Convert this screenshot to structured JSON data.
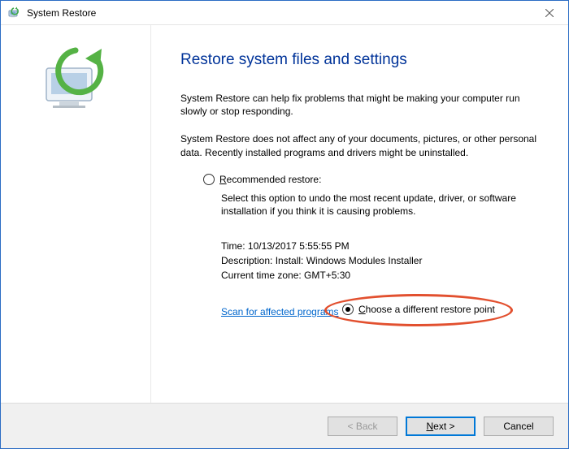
{
  "window": {
    "title": "System Restore"
  },
  "page": {
    "heading": "Restore system files and settings",
    "para1": "System Restore can help fix problems that might be making your computer run slowly or stop responding.",
    "para2": "System Restore does not affect any of your documents, pictures, or other personal data. Recently installed programs and drivers might be uninstalled."
  },
  "options": {
    "recommended": {
      "label_prefix": "R",
      "label_rest": "ecommended restore:",
      "desc": "Select this option to undo the most recent update, driver, or software installation if you think it is causing problems.",
      "time_label": "Time: ",
      "time_value": "10/13/2017 5:55:55 PM",
      "desc_label": "Description: ",
      "desc_value": "Install: Windows Modules Installer",
      "tz_label": "Current time zone: ",
      "tz_value": "GMT+5:30",
      "scan_link": "Scan for affected programs"
    },
    "choose": {
      "label_prefix": "C",
      "label_rest": "hoose a different restore point"
    },
    "selected": "choose"
  },
  "buttons": {
    "back": "< Back",
    "next_prefix": "N",
    "next_rest": "ext >",
    "cancel": "Cancel"
  }
}
